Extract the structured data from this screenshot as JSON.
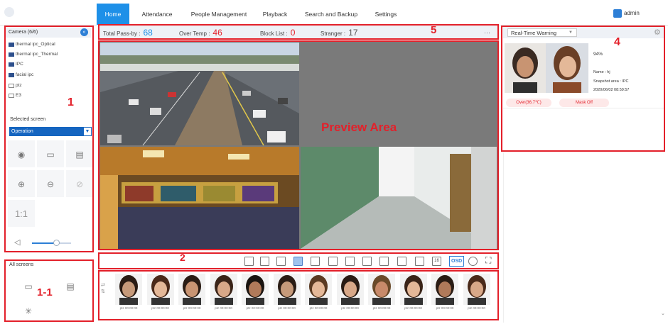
{
  "nav": {
    "tabs": [
      "Home",
      "Attendance",
      "People Management",
      "Playback",
      "Search and Backup",
      "Settings"
    ],
    "active_index": 0,
    "user": "admin"
  },
  "camera_panel": {
    "title": "Camera (6/6)",
    "cameras": [
      {
        "name": "thermal ipc_Optical",
        "online": true
      },
      {
        "name": "thermal ipc_Thermal",
        "online": true
      },
      {
        "name": "IPC",
        "online": true
      },
      {
        "name": "facial ipc",
        "online": true
      },
      {
        "name": "ptz",
        "online": false
      },
      {
        "name": "E3",
        "online": false
      }
    ],
    "selected_screen_label": "Selected screen",
    "operation_value": "Operation",
    "zoom_ratio_label": "1:1",
    "volume": 0.62
  },
  "all_screens": {
    "title": "All screens"
  },
  "stats": {
    "total_label": "Total Pass-by :",
    "total_value": "68",
    "overtemp_label": "Over Temp :",
    "overtemp_value": "46",
    "blocklist_label": "Block List :",
    "blocklist_value": "0",
    "stranger_label": "Stranger :",
    "stranger_value": "17",
    "more": "···"
  },
  "preview": {
    "label": "Preview Area"
  },
  "layout_bar": {
    "osd": "OSD",
    "split_16": "16"
  },
  "warning_panel": {
    "title": "Real-Time Warning",
    "similarity": "94%",
    "name": "Name : hj",
    "snapshot_area": "Snapshot area : IPC",
    "time": "2020/06/02 08:59:57",
    "temp_pill": "Over(36.7℃)",
    "mask_pill": "Mask Off"
  },
  "face_strip": {
    "captions": [
      "ptz 00:00:00",
      "ptz 00:00:00",
      "ptz 00:00:00",
      "ptz 00:00:00",
      "ptz 00:00:00",
      "ptz 00:00:00",
      "ptz 00:00:00",
      "ptz 00:00:00",
      "ptz 00:00:00",
      "ptz 00:00:00",
      "ptz 00:00:00",
      "ptz 00:00:00"
    ]
  },
  "annotations": {
    "n1": "1",
    "n11": "1-1",
    "n2": "2",
    "n4": "4",
    "n5": "5"
  },
  "colors": {
    "accent": "#1e90e8",
    "annotation_red": "#e3202a",
    "stat_value": "#1e90e8"
  }
}
